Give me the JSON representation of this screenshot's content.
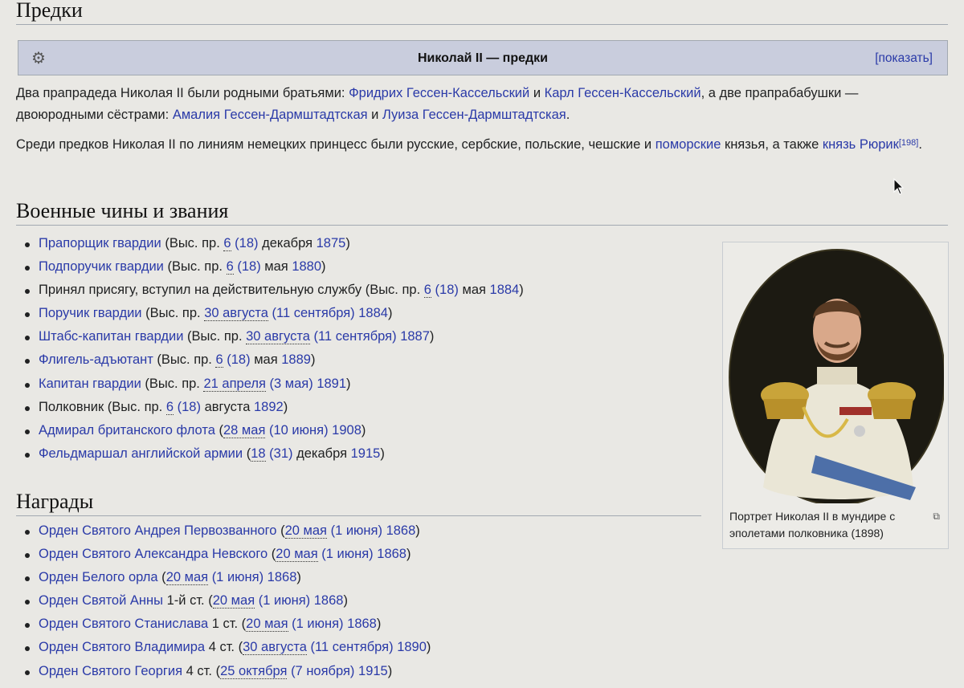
{
  "sections": {
    "ancestors": "Предки",
    "military": "Военные чины и звания",
    "awards": "Награды"
  },
  "navbox": {
    "title": "Николай II — предки",
    "toggle": "[показать]"
  },
  "para1": {
    "t1": "Два прапрадеда Николая II были родными братьями: ",
    "l1": "Фридрих Гессен-Кассельский",
    "t2": " и ",
    "l2": "Карл Гессен-Кассельский",
    "t3": ", а две прапрабабушки — двоюродными сёстрами: ",
    "l3": "Амалия Гессен-Дармштадтская",
    "t4": " и ",
    "l4": "Луиза Гессен-Дармштадтская",
    "t5": "."
  },
  "para2": {
    "t1": "Среди предков Николая II по линиям немецких принцесс были русские, сербские, польские, чешские и ",
    "l1": "поморские",
    "t2": " князья, а также ",
    "l2": "князь Рюрик",
    "ref": "[198]",
    "t3": "."
  },
  "ranks": [
    {
      "pre": "",
      "link": "Прапорщик гвардии",
      "text": " (Выс. пр. ",
      "d1": "6",
      "d2": "(18)",
      "tail": " декабря ",
      "year": "1875",
      "end": ")"
    },
    {
      "pre": "",
      "link": "Подпоручик гвардии",
      "text": " (Выс. пр. ",
      "d1": "6",
      "d2": "(18)",
      "tail": " мая ",
      "year": "1880",
      "end": ")"
    },
    {
      "pre": "Принял присягу, вступил на действительную службу",
      "link": "",
      "text": " (Выс. пр. ",
      "d1": "6",
      "d2": "(18)",
      "tail": " мая ",
      "year": "1884",
      "end": ")"
    },
    {
      "pre": "",
      "link": "Поручик гвардии",
      "text": " (Выс. пр. ",
      "d1": "30 августа",
      "d2": "(11 сентября)",
      "tail": " ",
      "year": "1884",
      "end": ")"
    },
    {
      "pre": "",
      "link": "Штабс-капитан гвардии",
      "text": " (Выс. пр. ",
      "d1": "30 августа",
      "d2": "(11 сентября)",
      "tail": " ",
      "year": "1887",
      "end": ")"
    },
    {
      "pre": "",
      "link": "Флигель-адъютант",
      "text": " (Выс. пр. ",
      "d1": "6",
      "d2": "(18)",
      "tail": " мая ",
      "year": "1889",
      "end": ")"
    },
    {
      "pre": "",
      "link": "Капитан гвардии",
      "text": " (Выс. пр. ",
      "d1": "21 апреля",
      "d2": "(3 мая)",
      "tail": " ",
      "year": "1891",
      "end": ")"
    },
    {
      "pre": "Полковник",
      "link": "",
      "text": " (Выс. пр. ",
      "d1": "6",
      "d2": "(18)",
      "tail": " августа ",
      "year": "1892",
      "end": ")"
    },
    {
      "pre": "",
      "link": "Адмирал британского флота",
      "text": " (",
      "d1": "28 мая",
      "d2": "(10 июня)",
      "tail": " ",
      "year": "1908",
      "end": ")"
    },
    {
      "pre": "",
      "link": "Фельдмаршал английской армии",
      "text": " (",
      "d1": "18",
      "d2": "(31)",
      "tail": " декабря ",
      "year": "1915",
      "end": ")"
    }
  ],
  "awards": [
    {
      "link": "Орден Святого Андрея Первозванного",
      "mid": "",
      "d1": "20 мая",
      "d2": "(1 июня)",
      "year": "1868"
    },
    {
      "link": "Орден Святого Александра Невского",
      "mid": "",
      "d1": "20 мая",
      "d2": "(1 июня)",
      "year": "1868"
    },
    {
      "link": "Орден Белого орла",
      "mid": "",
      "d1": "20 мая",
      "d2": "(1 июня)",
      "year": "1868"
    },
    {
      "link": "Орден Святой Анны",
      "mid": " 1-й ст.",
      "d1": "20 мая",
      "d2": "(1 июня)",
      "year": "1868"
    },
    {
      "link": "Орден Святого Станислава",
      "mid": " 1 ст.",
      "d1": "20 мая",
      "d2": "(1 июня)",
      "year": "1868"
    },
    {
      "link": "Орден Святого Владимира",
      "mid": " 4 ст.",
      "d1": "30 августа",
      "d2": "(11 сентября)",
      "year": "1890"
    },
    {
      "link": "Орден Святого Георгия",
      "mid": " 4 ст.",
      "d1": "25 октября",
      "d2": "(7 ноября)",
      "year": "1915"
    }
  ],
  "thumb": {
    "caption": "Портрет Николая II в мундире с эполетами полковника (1898)"
  },
  "colors": {
    "link": "#2a3aa8",
    "navbox": "#c9cddd",
    "bg": "#e9e8e4"
  },
  "icons": {
    "navbox": "gear-icon",
    "thumb": "magnify-icon",
    "pointer": "cursor-icon"
  }
}
